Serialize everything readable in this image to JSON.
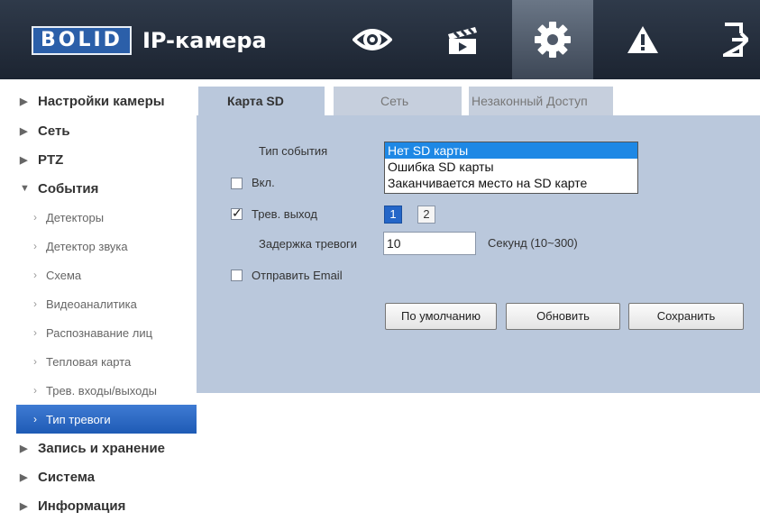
{
  "header": {
    "logo_text": "BOLID",
    "title": "IP-камера",
    "nav": [
      {
        "icon": "eye-icon"
      },
      {
        "icon": "clapperboard-icon"
      },
      {
        "icon": "gear-icon"
      },
      {
        "icon": "warning-icon"
      },
      {
        "icon": "logout-icon"
      }
    ]
  },
  "sidebar": {
    "items": [
      {
        "label": "Настройки камеры",
        "expanded": false
      },
      {
        "label": "Сеть",
        "expanded": false
      },
      {
        "label": "PTZ",
        "expanded": false
      },
      {
        "label": "События",
        "expanded": true
      }
    ],
    "sub_items": [
      {
        "label": "Детекторы"
      },
      {
        "label": "Детектор звука"
      },
      {
        "label": "Схема"
      },
      {
        "label": "Видеоаналитика"
      },
      {
        "label": "Распознавание лиц"
      },
      {
        "label": "Тепловая карта"
      },
      {
        "label": "Трев. входы/выходы"
      },
      {
        "label": "Тип тревоги",
        "active": true
      }
    ],
    "items_after": [
      {
        "label": "Запись и хранение"
      },
      {
        "label": "Система"
      },
      {
        "label": "Информация"
      }
    ]
  },
  "tabs": [
    {
      "label": "Карта SD",
      "active": true
    },
    {
      "label": "Сеть"
    },
    {
      "label": "Незаконный Доступ"
    }
  ],
  "form": {
    "event_type_label": "Тип события",
    "event_type_options": [
      "Нет SD карты",
      "Ошибка SD карты",
      "Заканчивается место на SD карте"
    ],
    "event_type_selected": "Нет SD карты",
    "enable_label": "Вкл.",
    "enable_checked": false,
    "alarm_out_label": "Трев. выход",
    "alarm_out_checked": true,
    "alarm_out_channels": [
      "1",
      "2"
    ],
    "alarm_out_selected": "1",
    "delay_label": "Задержка тревоги",
    "delay_value": "10",
    "delay_unit": "Секунд (10~300)",
    "email_label": "Отправить Email",
    "email_checked": false
  },
  "buttons": {
    "default": "По умолчанию",
    "refresh": "Обновить",
    "save": "Сохранить"
  },
  "colors": {
    "header_bg": "#1c2431",
    "content_bg": "#bac8dc",
    "accent": "#2466c8",
    "selected_option": "#1e88e5"
  }
}
